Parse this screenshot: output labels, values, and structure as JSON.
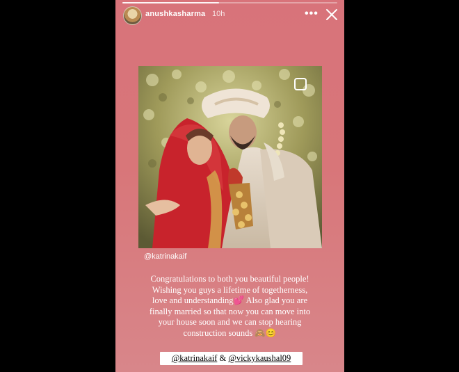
{
  "story": {
    "username": "anushkasharma",
    "time_ago": "10h",
    "progress_fraction": 0.45,
    "more_label": "•••",
    "photo_tag": "@katrinakaif",
    "caption_lines": [
      "Congratulations to both you beautiful people!",
      "Wishing you guys a lifetime of togetherness,",
      "love and understanding💕 Also glad you are",
      "finally married so that now you can move into",
      "your house soon and we can stop hearing",
      "construction sounds 🙈😊"
    ],
    "mentions": {
      "first": "@katrinakaif",
      "separator": " & ",
      "second": "@vickykaushal09"
    }
  },
  "icons": {
    "avatar": "avatar",
    "more": "more-dots-icon",
    "close": "close-icon",
    "sticker": "square-sticker-icon"
  },
  "colors": {
    "background": "#000000",
    "story_bg": "#d8737a",
    "text": "#ffffff",
    "bride_red": "#c8232c",
    "turban_cream": "#efe4d6"
  }
}
